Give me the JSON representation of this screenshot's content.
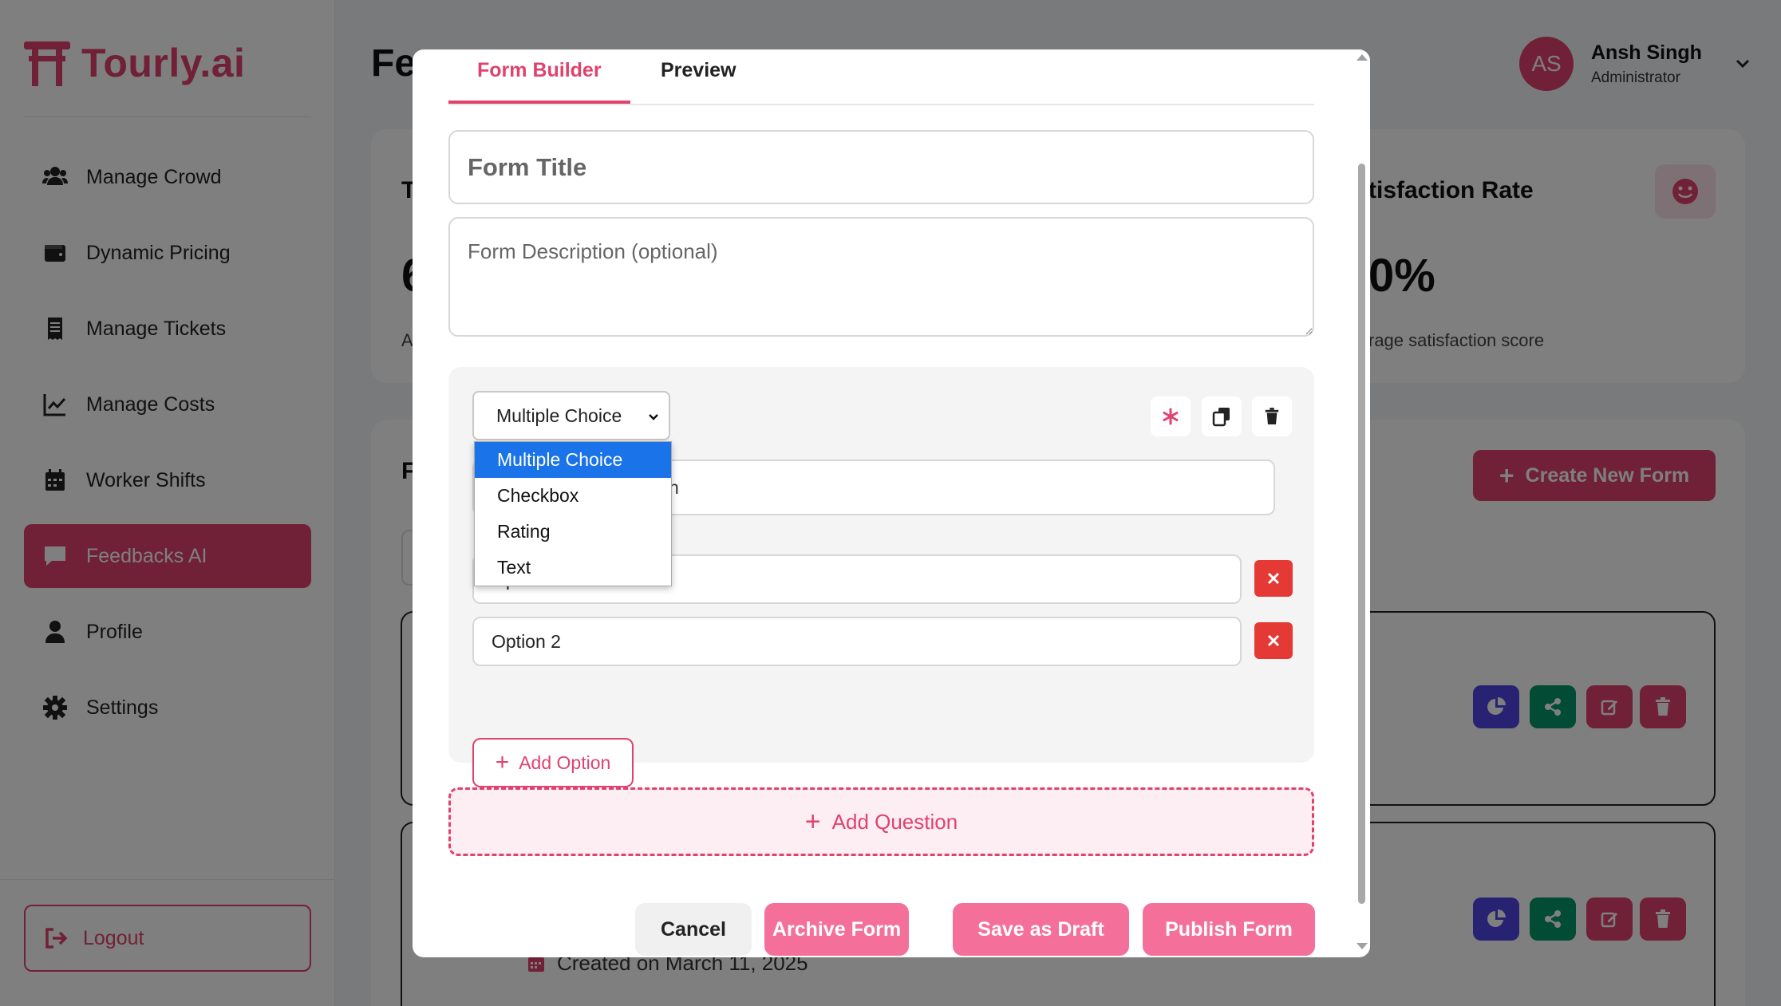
{
  "app": {
    "name": "Tourly.ai",
    "page_title": "Fe"
  },
  "sidebar": {
    "items": [
      {
        "label": "Manage Crowd",
        "icon": "users-icon"
      },
      {
        "label": "Dynamic Pricing",
        "icon": "wallet-icon"
      },
      {
        "label": "Manage Tickets",
        "icon": "receipt-icon"
      },
      {
        "label": "Manage Costs",
        "icon": "chart-line-icon"
      },
      {
        "label": "Worker Shifts",
        "icon": "calendar-icon"
      },
      {
        "label": "Feedbacks AI",
        "icon": "comment-icon",
        "active": true
      },
      {
        "label": "Profile",
        "icon": "user-icon"
      },
      {
        "label": "Settings",
        "icon": "gear-icon"
      }
    ],
    "logout_label": "Logout"
  },
  "user": {
    "initials": "AS",
    "name": "Ansh Singh",
    "role": "Administrator"
  },
  "stats": {
    "left_title_fragment": "T",
    "left_value_fragment": "6",
    "left_sub_fragment": "A",
    "right_title": "tisfaction Rate",
    "right_value": "0%",
    "right_sub": "rage satisfaction score"
  },
  "forms_section": {
    "title_fragment": "F",
    "create_label": "Create New Form",
    "created_label": "Created on March 11, 2025"
  },
  "modal": {
    "tabs": [
      "Form Builder",
      "Preview"
    ],
    "active_tab": "Form Builder",
    "title_placeholder": "Form Title",
    "description_placeholder": "Form Description (optional)",
    "question": {
      "type_selected": "Multiple Choice",
      "type_options": [
        "Multiple Choice",
        "Checkbox",
        "Rating",
        "Text"
      ],
      "question_fragment": "n",
      "options": [
        "Option 1",
        "Option 2"
      ],
      "add_option_label": "Add Option"
    },
    "add_question_label": "Add Question",
    "buttons": {
      "cancel": "Cancel",
      "archive": "Archive Form",
      "draft": "Save as Draft",
      "publish": "Publish Form"
    }
  },
  "colors": {
    "brand": "#e0426e",
    "brand_light": "#f4709a",
    "danger": "#e53935",
    "purple": "#4f46e5",
    "green": "#059669"
  }
}
